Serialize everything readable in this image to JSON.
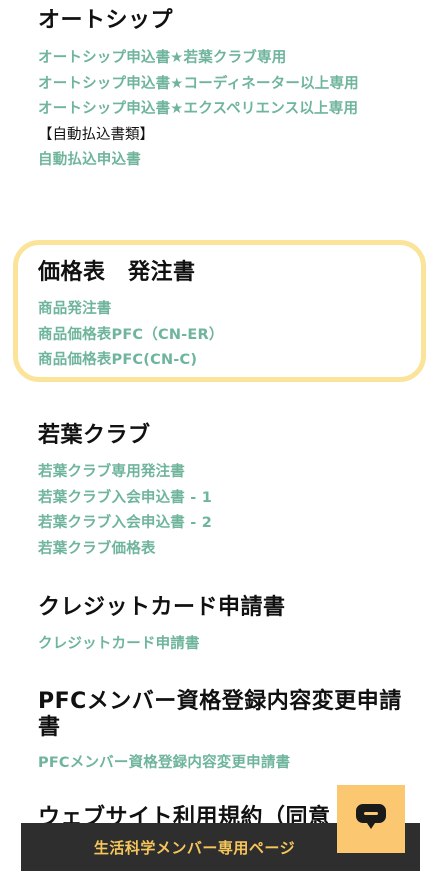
{
  "autoship": {
    "heading": "オートシップ",
    "links": [
      "オートシップ申込書★若葉クラブ専用",
      "オートシップ申込書★コーディネーター以上専用",
      "オートシップ申込書★エクスペリエンス以上専用"
    ],
    "subheading": "【自動払込書類】",
    "links2": [
      "自動払込申込書"
    ]
  },
  "price": {
    "heading": "価格表　発注書",
    "links": [
      "商品発注書",
      "商品価格表PFC（CN-ER）",
      "商品価格表PFC(CN-C)"
    ]
  },
  "wakaba": {
    "heading": "若葉クラブ",
    "links": [
      "若葉クラブ専用発注書",
      "若葉クラブ入会申込書 - 1",
      "若葉クラブ入会申込書 - 2",
      "若葉クラブ価格表"
    ]
  },
  "credit": {
    "heading": "クレジットカード申請書",
    "links": [
      "クレジットカード申請書"
    ]
  },
  "pfc": {
    "heading": "PFCメンバー資格登録内容変更申請書",
    "links": [
      "PFCメンバー資格登録内容変更申請書"
    ]
  },
  "website": {
    "heading": "ウェブサイト利用規約（同意"
  },
  "bottom_bar": {
    "label": "生活科学メンバー専用ページ"
  },
  "chat": {
    "icon": "chat-bubble-icon"
  },
  "colors": {
    "link": "#6fb59b",
    "highlight_border": "#fbe49a",
    "bar_bg": "#2e2e2e",
    "bar_text": "#f6c65b",
    "chat_bg": "#fbc770"
  }
}
